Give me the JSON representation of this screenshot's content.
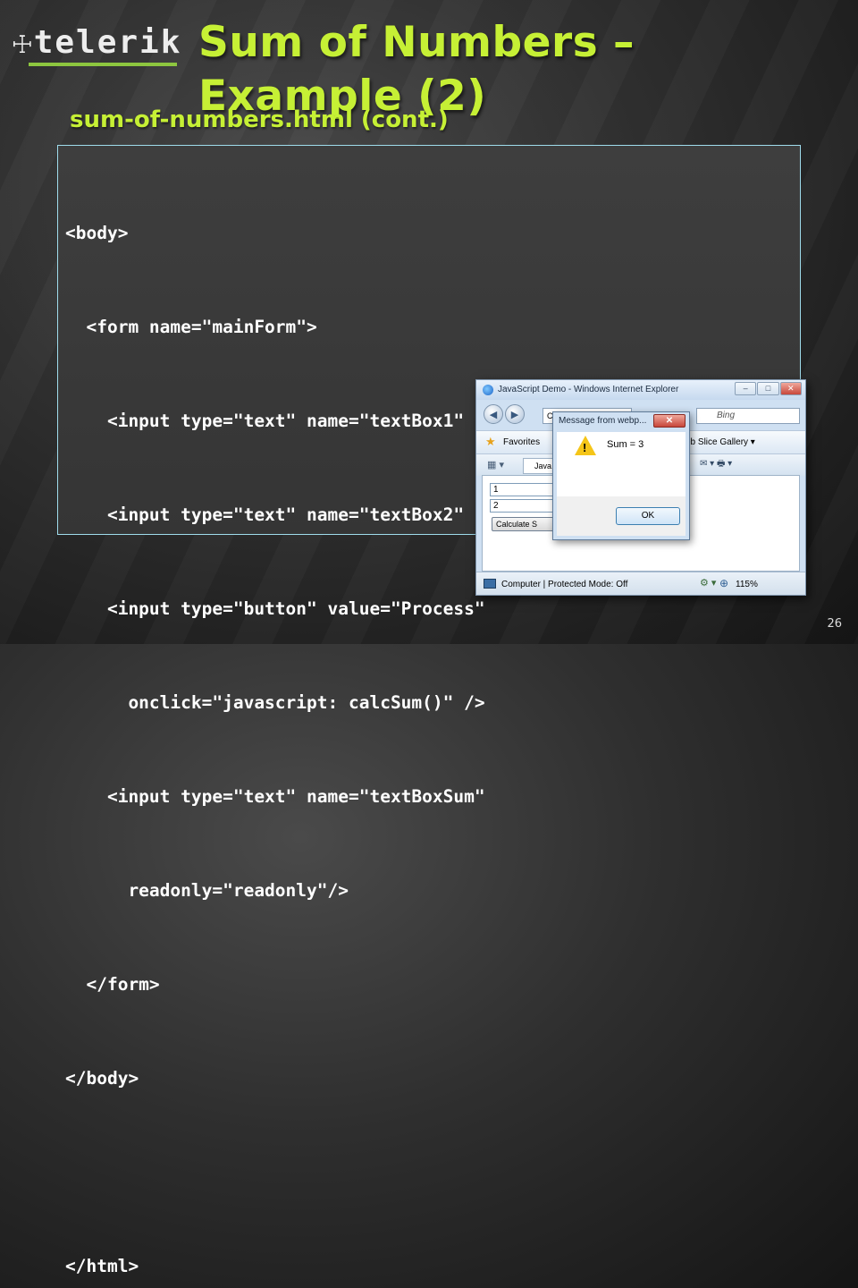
{
  "logo": {
    "text": "telerik"
  },
  "slide": {
    "title": "Sum of Numbers – Example (2)",
    "subtitle": "sum-of-numbers.html (cont.)",
    "page_number": "26"
  },
  "code_lines": [
    "<body>",
    "  <form name=\"mainForm\">",
    "    <input type=\"text\" name=\"textBox1\" /> <br/>",
    "    <input type=\"text\" name=\"textBox2\" /> <br/>",
    "    <input type=\"button\" value=\"Process\"",
    "      onclick=\"javascript: calcSum()\" />",
    "    <input type=\"text\" name=\"textBoxSum\"",
    "      readonly=\"readonly\"/>",
    "  </form>",
    "</body>",
    "",
    "</html>"
  ],
  "browser": {
    "window_title": "JavaScript Demo - Windows Internet Explorer",
    "address": "C:\\...\\Sum...",
    "search_placeholder": "Bing",
    "favorites_label": "Favorites",
    "web_slice_gallery": "eb Slice Gallery ▾",
    "tab_label": "Java...",
    "textbox1_value": "1",
    "textbox2_value": "2",
    "calculate_button": "Calculate S",
    "status_text": "Computer | Protected Mode: Off",
    "zoom": "115%"
  },
  "dialog": {
    "title": "Message from webp...",
    "message": "Sum = 3",
    "ok_label": "OK"
  },
  "colors": {
    "title": "#c6f035",
    "code_border": "#9fdcec",
    "logo_bar": "#8dc63f"
  }
}
